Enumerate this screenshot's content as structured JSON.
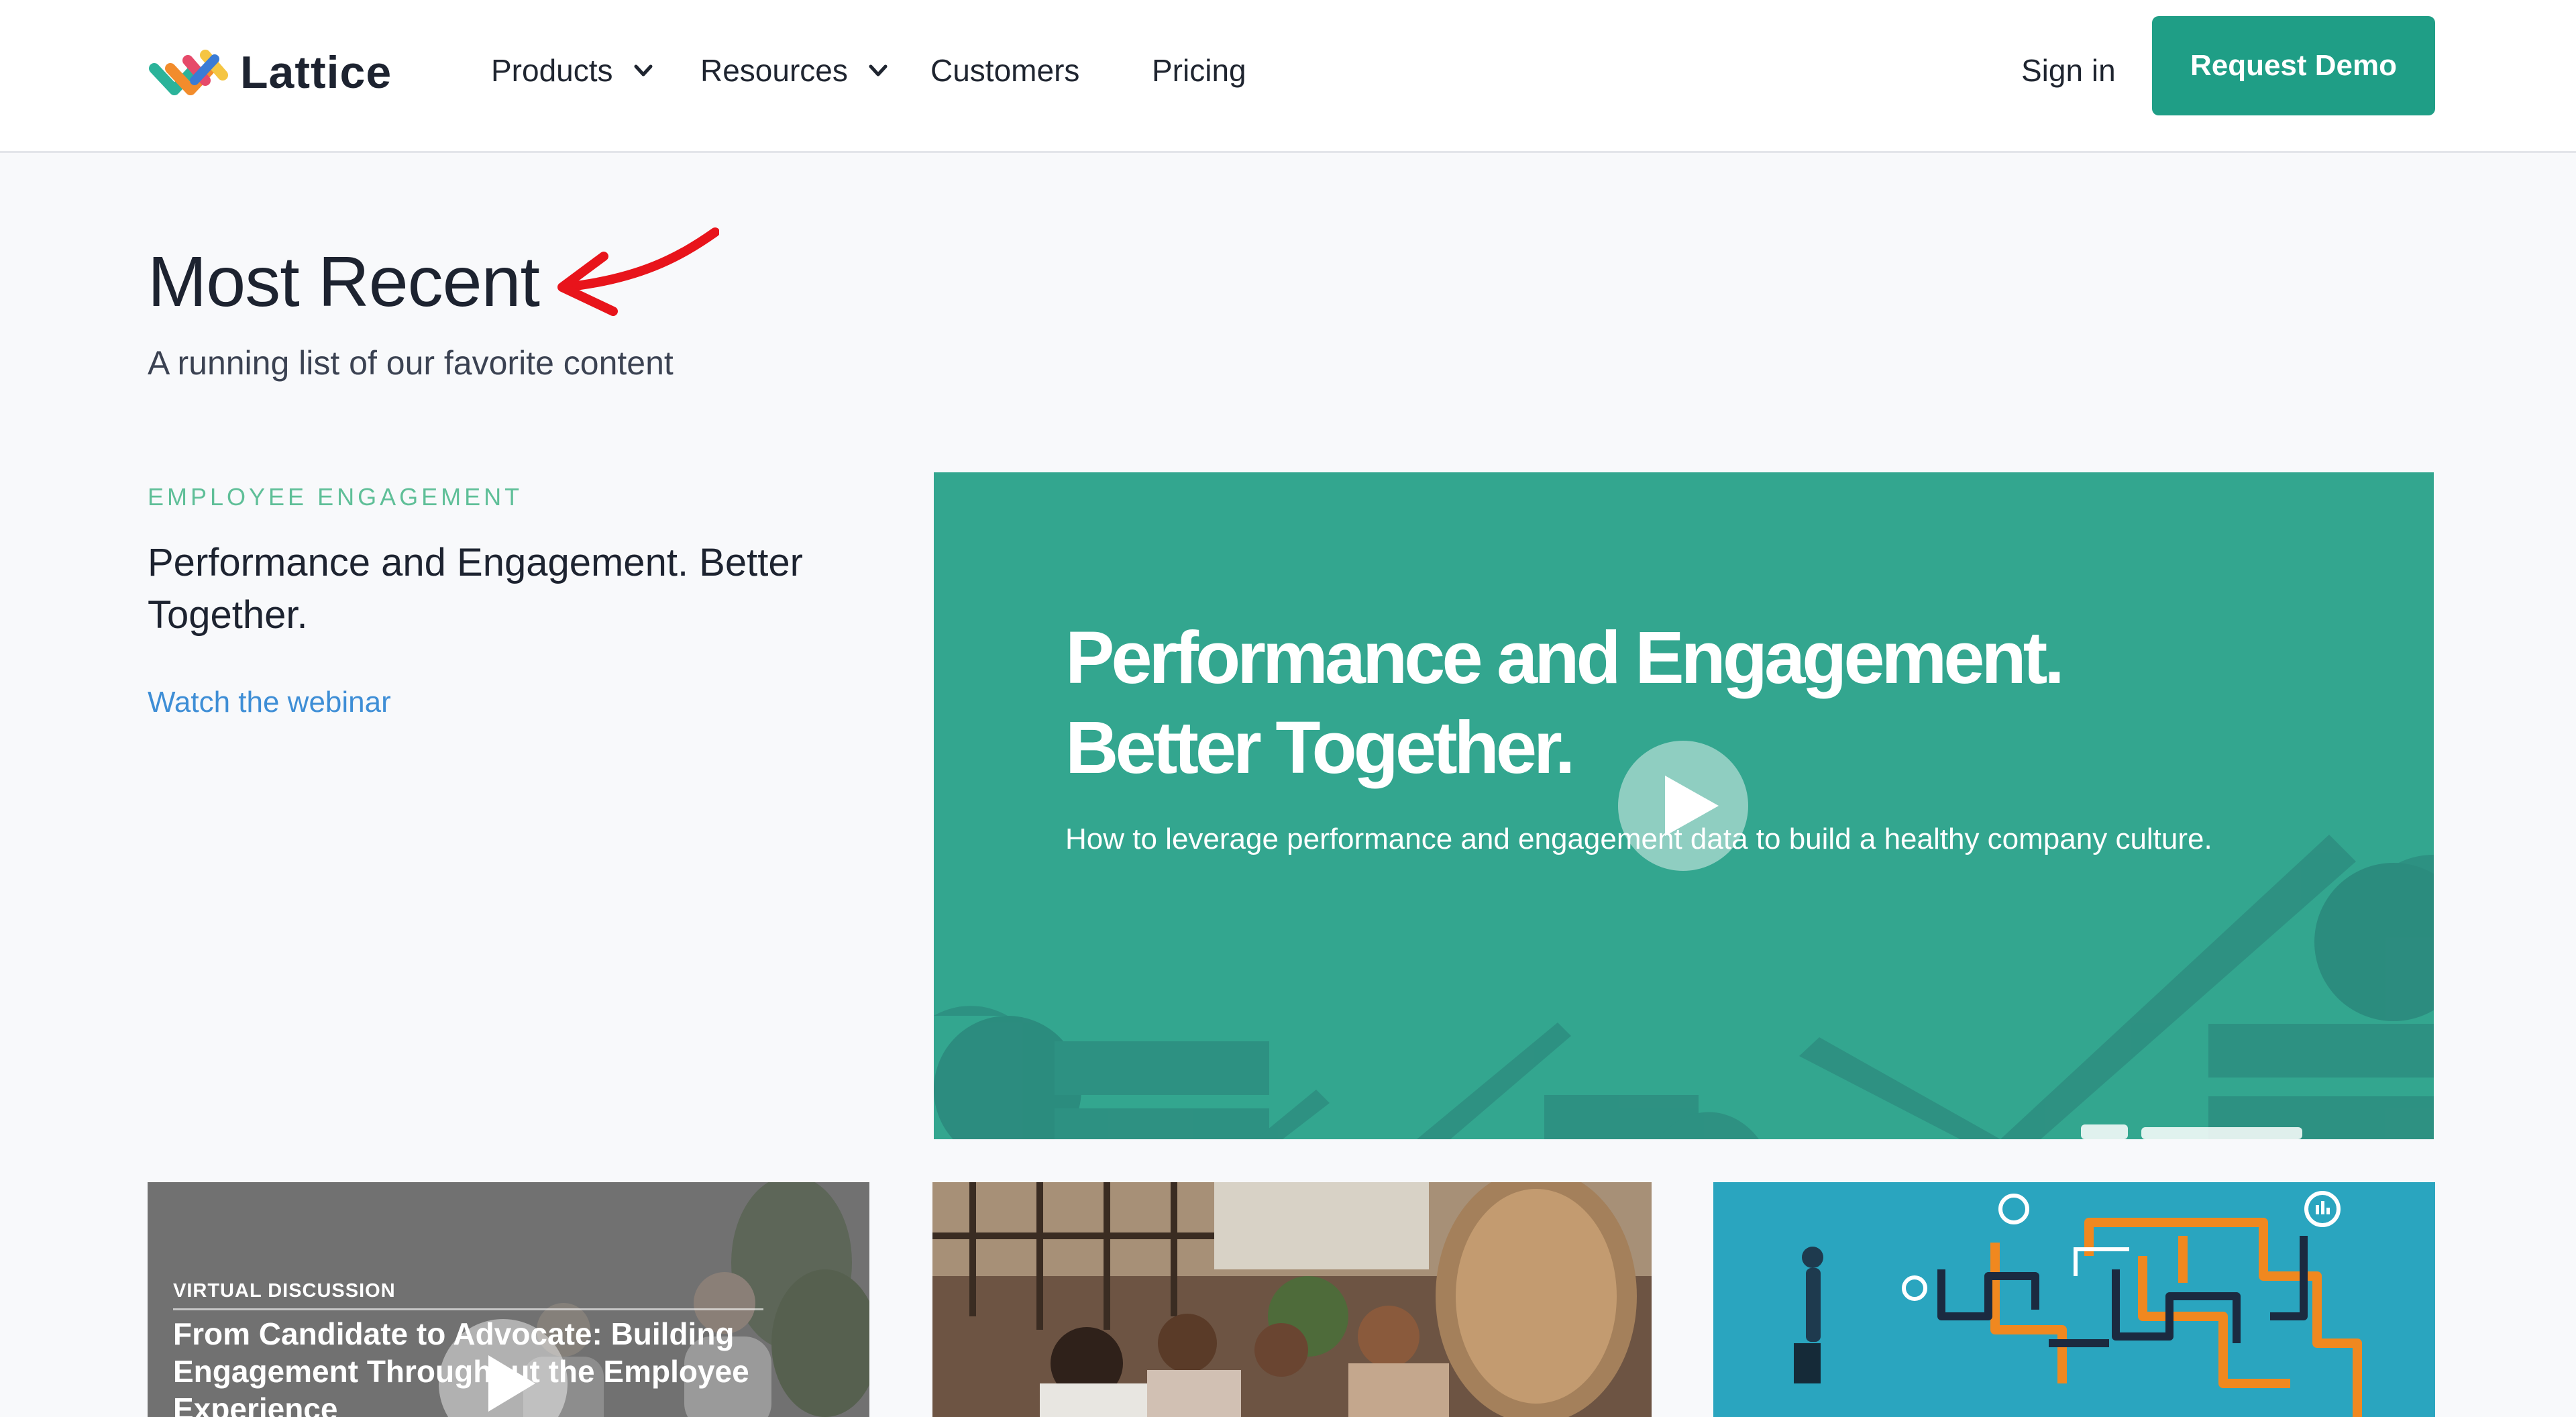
{
  "header": {
    "brand": "Lattice",
    "nav": [
      {
        "label": "Products",
        "dropdown": true
      },
      {
        "label": "Resources",
        "dropdown": true
      },
      {
        "label": "Customers",
        "dropdown": false
      },
      {
        "label": "Pricing",
        "dropdown": false
      }
    ],
    "sign_in": "Sign in",
    "cta": "Request Demo"
  },
  "section": {
    "title": "Most Recent",
    "subtitle": "A running list of our favorite content"
  },
  "featured": {
    "category": "EMPLOYEE ENGAGEMENT",
    "title": "Performance and Engagement. Better Together.",
    "link": "Watch the webinar",
    "hero_title_line1": "Performance and Engagement.",
    "hero_title_line2": "Better Together.",
    "hero_subtitle": "How to leverage performance and engagement data to build a healthy company culture."
  },
  "cards": [
    {
      "tag": "VIRTUAL DISCUSSION",
      "title": "From Candidate to Advocate: Building Engagement Throughout the Employee Experience"
    },
    {
      "image": "team-meeting-photo"
    },
    {
      "image": "maze-illustration"
    }
  ],
  "colors": {
    "accent": "#1f9e86",
    "hero_bg": "#33a68f",
    "category_text": "#5fbf98",
    "link": "#3e8ed6",
    "annotation_arrow": "#e8141b"
  },
  "icons": [
    "lattice-logo-icon",
    "chevron-down-icon",
    "play-icon",
    "red-arrow-annotation"
  ]
}
